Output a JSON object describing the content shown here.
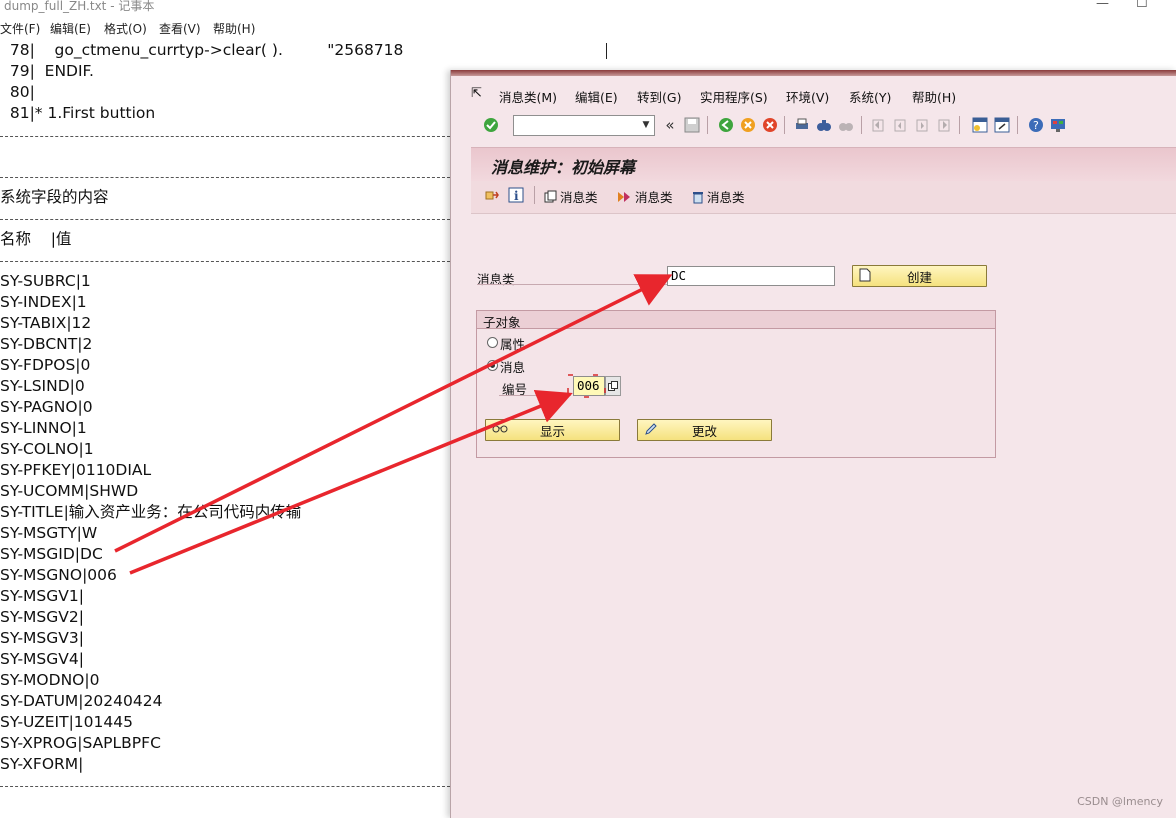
{
  "notepad": {
    "title": "dump_full_ZH.txt - 记事本",
    "menu": [
      "文件(F)",
      "编辑(E)",
      "格式(O)",
      "查看(V)",
      "帮助(H)"
    ],
    "code_lines": [
      "  78|    go_ctmenu_currtyp->clear( ).         \"2568718",
      "  79|  ENDIF.",
      "  80|",
      "  81|* 1.First buttion"
    ],
    "section_title": "系统字段的内容",
    "header_row": "名称    |值",
    "fields": [
      "SY-SUBRC|1",
      "SY-INDEX|1",
      "SY-TABIX|12",
      "SY-DBCNT|2",
      "SY-FDPOS|0",
      "SY-LSIND|0",
      "SY-PAGNO|0",
      "SY-LINNO|1",
      "SY-COLNO|1",
      "SY-PFKEY|0110DIAL",
      "SY-UCOMM|SHWD",
      "SY-TITLE|输入资产业务：在公司代码内传输",
      "SY-MSGTY|W",
      "SY-MSGID|DC",
      "SY-MSGNO|006",
      "SY-MSGV1|",
      "SY-MSGV2|",
      "SY-MSGV3|",
      "SY-MSGV4|",
      "SY-MODNO|0",
      "SY-DATUM|20240424",
      "SY-UZEIT|101445",
      "SY-XPROG|SAPLBPFC",
      "SY-XFORM|"
    ]
  },
  "sap": {
    "menu": [
      "消息类(M)",
      "编辑(E)",
      "转到(G)",
      "实用程序(S)",
      "环境(V)",
      "系统(Y)",
      "帮助(H)"
    ],
    "command_value": "",
    "title": "消息维护：初始屏幕",
    "app_toolbar": [
      "消息类",
      "消息类",
      "消息类"
    ],
    "message_class_label": "消息类",
    "message_class_value": "DC",
    "create_button": "创建",
    "subobject_title": "子对象",
    "radio_attributes": "属性",
    "radio_messages": "消息",
    "number_label": "编号",
    "number_value": "006",
    "display_button": "显示",
    "change_button": "更改"
  },
  "watermark": "CSDN @lmency",
  "colors": {
    "arrow": "#e8262d",
    "sap_bg": "#f5e6ea",
    "button": "#f5e27e"
  }
}
